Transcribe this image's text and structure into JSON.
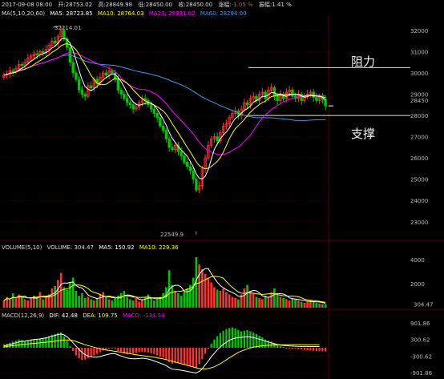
{
  "header": {
    "date": "2017-09-08 08:00",
    "open_label": "开:",
    "open": "28753.02",
    "high_label": "高:",
    "high": "28849.98",
    "low_label": "低:",
    "low": "28450.00",
    "close_label": "收:",
    "close": "28450.00",
    "change_label": "涨幅:",
    "change": "-1.05 %",
    "amplitude_label": "振幅:",
    "amplitude": "1.41 %"
  },
  "ma_legend": {
    "title": "MA(5,10,20,60)",
    "ma5": "MA5: 28723.85",
    "ma10": "MA10: 28764.03",
    "ma20": "MA20: 28831.62",
    "ma60": "MA60: 28294.00"
  },
  "volume_legend": {
    "title": "VOLUME(5,10)",
    "vol": "VOLUME: 304.47",
    "ma5": "MA5: 150.92",
    "ma10": "MA10: 229.36"
  },
  "macd_legend": {
    "title": "MACD(12,26,9)",
    "dif": "DIF: 42.48",
    "dea": "DEA: 109.75",
    "macd": "MACD: -134.54"
  },
  "annotations": {
    "resistance": "阻力",
    "support": "支撑",
    "high_mark": "32214.01",
    "low_mark": "22549.9",
    "last_price": "28450",
    "last_volume": "304.47"
  },
  "colors": {
    "up": "#ff3232",
    "down": "#00c800",
    "ma5": "#ffffff",
    "ma10": "#ffff00",
    "ma20": "#ff00ff",
    "ma60": "#3b9ce8",
    "dif": "#ffffff",
    "dea": "#ffff00",
    "grid": "#3a0000"
  },
  "chart_data": [
    {
      "type": "candlestick",
      "title": "",
      "y_ticks": [
        "32000",
        "31000",
        "30000",
        "29000",
        "28000",
        "27000",
        "26000",
        "25000",
        "24000",
        "23000"
      ],
      "ylim": [
        22200,
        32600
      ],
      "horizontal_lines": [
        30250,
        28000
      ],
      "close": [
        29900,
        29950,
        30100,
        30050,
        30200,
        30400,
        30350,
        30500,
        30700,
        30800,
        30900,
        30850,
        31000,
        30950,
        31100,
        31300,
        31500,
        31400,
        31700,
        32000,
        31600,
        31200,
        30500,
        30000,
        29700,
        29200,
        29000,
        28900,
        29400,
        29300,
        29700,
        29500,
        29800,
        30000,
        29900,
        30100,
        30000,
        29700,
        29200,
        29000,
        28800,
        28600,
        28500,
        28300,
        28400,
        28600,
        28800,
        28700,
        28500,
        28300,
        28100,
        27900,
        27500,
        27300,
        26900,
        26500,
        26400,
        26600,
        26300,
        26100,
        25800,
        25600,
        25400,
        25000,
        24500,
        24700,
        25500,
        26000,
        26600,
        26900,
        27000,
        26800,
        27200,
        27500,
        27600,
        27900,
        28100,
        28200,
        28000,
        28300,
        28600,
        28500,
        28800,
        28900,
        28700,
        29000,
        29100,
        28800,
        29200,
        29300,
        28900,
        28700,
        29000,
        28800,
        29100,
        29200,
        28900,
        28800,
        29000,
        28700,
        28900,
        29000,
        29100,
        28850,
        28700,
        28900,
        28750,
        28450
      ],
      "volume_ticks": [
        "4000",
        "2000"
      ],
      "volume_ylim": [
        0,
        4800
      ],
      "volume": [
        600,
        900,
        700,
        1200,
        800,
        1100,
        900,
        700,
        600,
        800,
        1000,
        900,
        1300,
        700,
        900,
        1100,
        1600,
        1800,
        2300,
        2900,
        1700,
        1500,
        2100,
        2500,
        1400,
        1000,
        1200,
        800,
        900,
        700,
        600,
        800,
        1100,
        1300,
        900,
        700,
        600,
        800,
        1000,
        1200,
        1400,
        900,
        700,
        600,
        800,
        500,
        700,
        900,
        1100,
        800,
        600,
        700,
        900,
        1200,
        1700,
        3100,
        1900,
        1400,
        1200,
        1000,
        1300,
        1600,
        1900,
        2500,
        4200,
        3600,
        3200,
        2800,
        2500,
        2100,
        1700,
        1500,
        1400,
        1600,
        1300,
        1100,
        900,
        800,
        700,
        1100,
        1600,
        1900,
        1400,
        1200,
        900,
        800,
        700,
        1000,
        900,
        1300,
        1600,
        1100,
        900,
        800,
        700,
        600,
        800,
        700,
        600,
        500,
        400,
        500,
        600,
        500,
        400,
        350,
        300,
        304.47
      ],
      "macd_ticks": [
        "901.86",
        "300.62",
        "-300.62",
        "-901.86"
      ],
      "macd_ylim": [
        -1050,
        1050
      ],
      "macd_hist": [
        120,
        150,
        180,
        220,
        260,
        300,
        280,
        250,
        270,
        300,
        320,
        300,
        330,
        350,
        380,
        420,
        470,
        500,
        540,
        560,
        420,
        250,
        60,
        -120,
        -280,
        -380,
        -440,
        -430,
        -380,
        -330,
        -280,
        -220,
        -160,
        -100,
        -60,
        -20,
        10,
        -40,
        -120,
        -180,
        -220,
        -240,
        -230,
        -210,
        -190,
        -160,
        -140,
        -150,
        -170,
        -200,
        -240,
        -280,
        -320,
        -360,
        -420,
        -520,
        -580,
        -560,
        -540,
        -560,
        -600,
        -640,
        -660,
        -690,
        -720,
        -600,
        -420,
        -220,
        -40,
        150,
        300,
        420,
        540,
        620,
        680,
        720,
        740,
        700,
        650,
        600,
        620,
        640,
        600,
        560,
        500,
        440,
        380,
        300,
        260,
        220,
        160,
        100,
        60,
        30,
        10,
        -10,
        -20,
        -40,
        -50,
        -60,
        -80,
        -90,
        -100,
        -110,
        -120,
        -125,
        -130,
        -134.54
      ],
      "dif": [
        60,
        90,
        120,
        150,
        180,
        210,
        230,
        240,
        260,
        280,
        300,
        310,
        320,
        340,
        360,
        390,
        420,
        450,
        480,
        500,
        470,
        400,
        300,
        180,
        60,
        -60,
        -170,
        -250,
        -300,
        -330,
        -340,
        -340,
        -320,
        -290,
        -260,
        -230,
        -210,
        -220,
        -260,
        -300,
        -340,
        -370,
        -390,
        -400,
        -400,
        -390,
        -380,
        -390,
        -410,
        -440,
        -480,
        -520,
        -560,
        -600,
        -650,
        -720,
        -780,
        -790,
        -800,
        -820,
        -840,
        -860,
        -880,
        -900,
        -920,
        -860,
        -760,
        -620,
        -480,
        -330,
        -200,
        -80,
        30,
        120,
        200,
        270,
        320,
        350,
        370,
        380,
        390,
        400,
        390,
        370,
        340,
        310,
        280,
        240,
        210,
        180,
        150,
        120,
        100,
        85,
        75,
        65,
        60,
        55,
        50,
        48,
        47,
        46,
        45,
        44,
        43,
        42.48
      ],
      "dea": [
        30,
        45,
        60,
        75,
        90,
        105,
        120,
        130,
        140,
        150,
        160,
        170,
        180,
        190,
        200,
        210,
        225,
        240,
        255,
        270,
        280,
        285,
        280,
        260,
        230,
        190,
        150,
        110,
        80,
        50,
        20,
        -10,
        -40,
        -60,
        -80,
        -100,
        -115,
        -130,
        -145,
        -160,
        -175,
        -195,
        -215,
        -235,
        -255,
        -270,
        -285,
        -300,
        -315,
        -330,
        -345,
        -365,
        -385,
        -405,
        -430,
        -460,
        -490,
        -520,
        -550,
        -580,
        -610,
        -640,
        -670,
        -700,
        -730,
        -755,
        -770,
        -770,
        -755,
        -730,
        -690,
        -640,
        -580,
        -510,
        -440,
        -370,
        -300,
        -230,
        -170,
        -120,
        -80,
        -40,
        -5,
        20,
        40,
        55,
        70,
        80,
        90,
        100,
        105,
        108,
        110,
        112,
        113,
        114,
        114,
        114,
        113,
        113,
        112,
        112,
        111,
        111,
        110,
        109.75
      ]
    }
  ]
}
